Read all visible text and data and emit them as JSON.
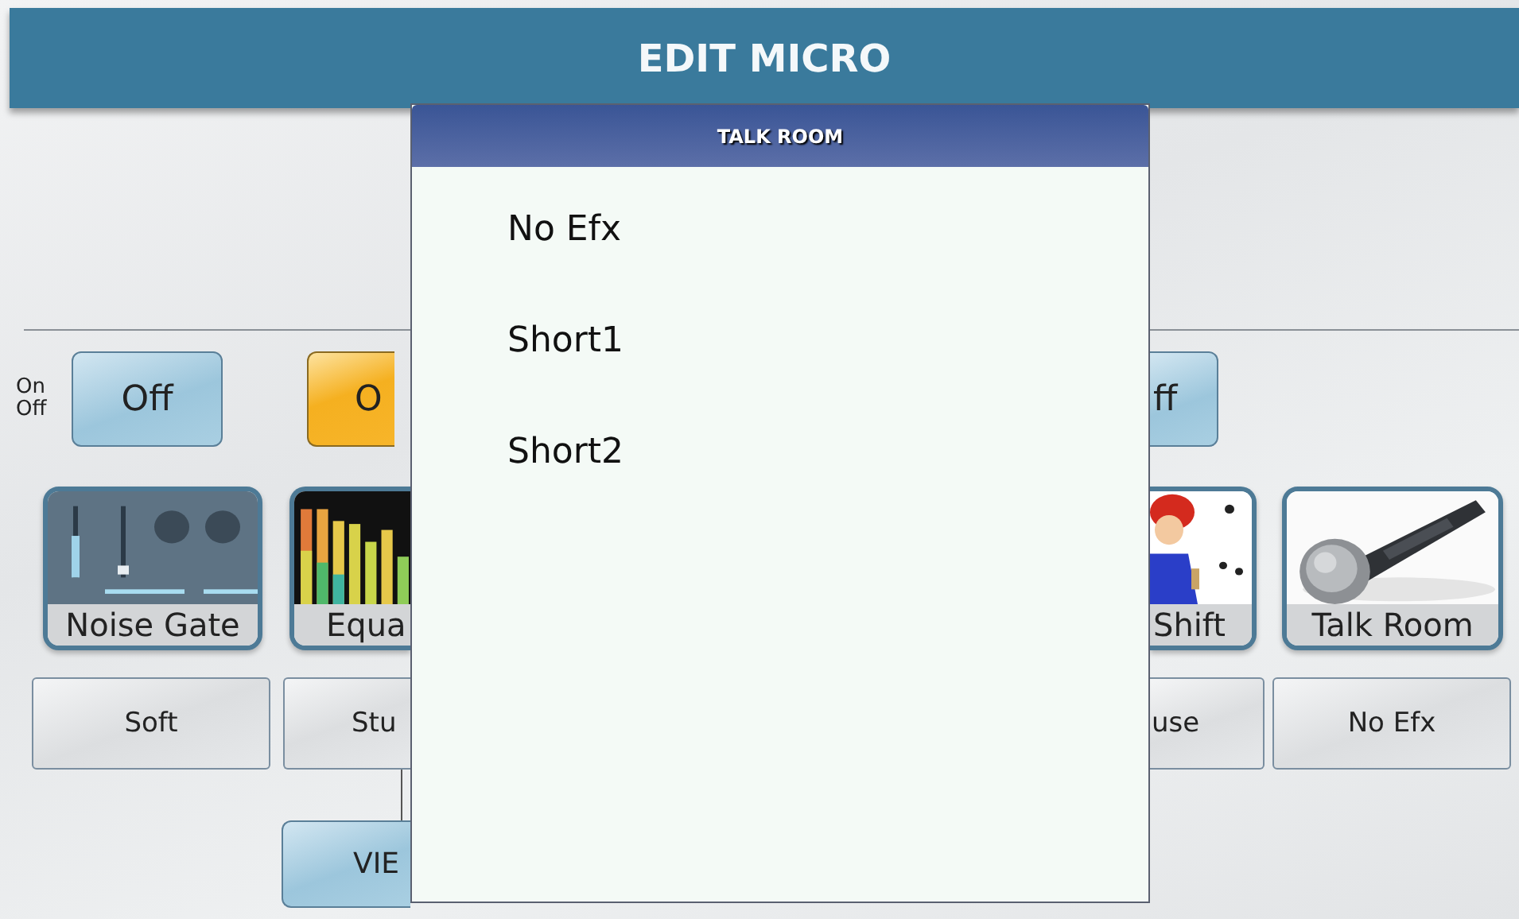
{
  "header": {
    "title": "EDIT MICRO"
  },
  "on_off_label": {
    "line_1": "On",
    "line_2": "Off"
  },
  "switches": [
    {
      "label": "Off",
      "on": false
    },
    {
      "label": "O",
      "on": true
    },
    {
      "label": "ff",
      "on": false
    }
  ],
  "effects": [
    {
      "label": "Noise Gate",
      "preset": "Soft",
      "kind": "gate"
    },
    {
      "label": "Equa",
      "preset": "Stu",
      "kind": "eq"
    },
    {
      "label": "Shift",
      "preset": "use",
      "kind": "cartoon"
    },
    {
      "label": "Talk Room",
      "preset": "No Efx",
      "kind": "mic"
    }
  ],
  "view_button": "VIE",
  "popup": {
    "title": "TALK ROOM",
    "items": [
      {
        "label": "No Efx",
        "selected": false
      },
      {
        "label": "Short1",
        "selected": false
      },
      {
        "label": "Short2",
        "selected": false
      }
    ]
  }
}
